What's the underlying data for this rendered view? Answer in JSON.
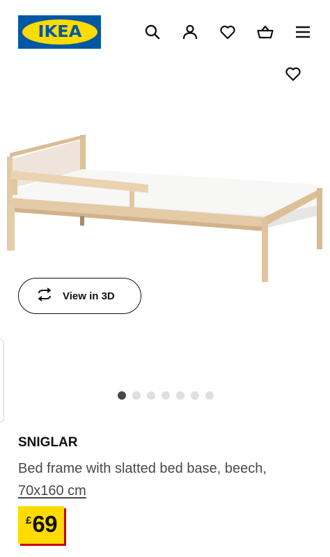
{
  "header": {
    "logo_text": "IKEA",
    "icons": [
      "search-icon",
      "account-icon",
      "heart-icon",
      "basket-icon",
      "menu-icon"
    ]
  },
  "product": {
    "name": "SNIGLAR",
    "description": "Bed frame with slatted bed base, beech,",
    "size": "70x160 cm",
    "price_currency": "£",
    "price_amount": "69"
  },
  "view3d": {
    "label": "View in 3D"
  },
  "carousel": {
    "total": 7,
    "active": 1
  },
  "colors": {
    "brand_blue": "#0058a3",
    "brand_yellow": "#ffdb00",
    "price_red": "#cc0008"
  }
}
